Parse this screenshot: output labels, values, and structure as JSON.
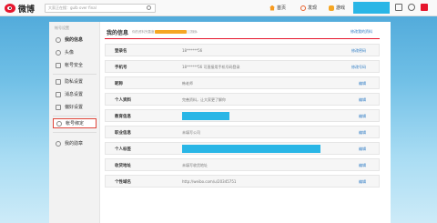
{
  "header": {
    "logo_text": "微博",
    "search_placeholder": "大家正在搜：gulb over final",
    "nav": [
      {
        "icon": "home-icon",
        "label": "首页"
      },
      {
        "icon": "discover-icon",
        "label": "发现"
      },
      {
        "icon": "game-icon",
        "label": "游戏"
      }
    ]
  },
  "sidebar": {
    "header": "帐号设置",
    "items": [
      {
        "label": "我的信息",
        "icon": "profile-icon"
      },
      {
        "label": "头像",
        "icon": "avatar-icon"
      },
      {
        "label": "帐号安全",
        "icon": "shield-icon"
      },
      {
        "label": "隐私设置",
        "icon": "lock-icon"
      },
      {
        "label": "消息设置",
        "icon": "message-icon"
      },
      {
        "label": "偏好设置",
        "icon": "preference-icon"
      },
      {
        "label": "帐号绑定",
        "icon": "bind-icon"
      },
      {
        "label": "我的勋章",
        "icon": "medal-icon"
      }
    ]
  },
  "content": {
    "title": "我的信息",
    "completion_text": "你的资料完善度",
    "completion_value": 0.75,
    "completion_percent": "75%",
    "top_link": "修改我的资料",
    "rows": [
      {
        "label": "登录名",
        "value": "18******56",
        "action": "修改密码"
      },
      {
        "label": "手机号",
        "value": "18******56 可直接用手机号码登录",
        "action": "修改号码"
      },
      {
        "label": "昵称",
        "value": "韩老师",
        "action": "编辑"
      },
      {
        "label": "个人资料",
        "value": "完善资料，让大家更了解你",
        "action": "编辑"
      },
      {
        "label": "教育信息",
        "value": "",
        "action": "编辑"
      },
      {
        "label": "职业信息",
        "value": "未填写公司",
        "action": "编辑"
      },
      {
        "label": "个人标签",
        "value": "",
        "action": "编辑"
      },
      {
        "label": "收货地址",
        "value": "未填写收货地址",
        "action": "编辑"
      },
      {
        "label": "个性域名",
        "value": "http://weibo.com/u/20345751",
        "action": "编辑"
      }
    ]
  },
  "colors": {
    "accent": "#e6162d",
    "link": "#2d7bc4",
    "progress": "#f5a623",
    "redaction": "#29b6e6"
  }
}
